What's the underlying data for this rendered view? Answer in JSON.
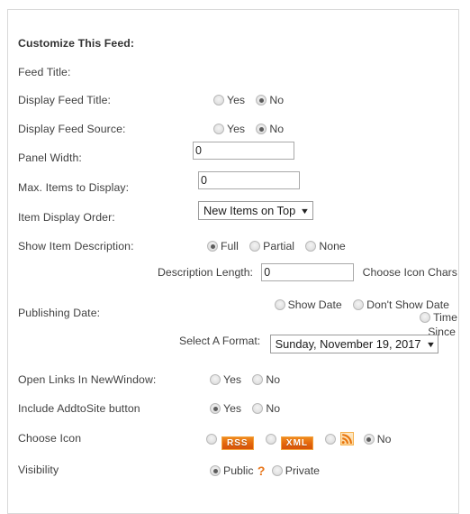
{
  "panel": {
    "title": "Customize This Feed:"
  },
  "fields": {
    "feed_title": {
      "label": "Feed Title:"
    },
    "display_feed_title": {
      "label": "Display Feed Title:",
      "options": [
        {
          "label": "Yes",
          "selected": false
        },
        {
          "label": "No",
          "selected": true
        }
      ]
    },
    "display_feed_source": {
      "label": "Display Feed Source:",
      "options": [
        {
          "label": "Yes",
          "selected": false
        },
        {
          "label": "No",
          "selected": true
        }
      ]
    },
    "panel_width": {
      "label": "Panel Width:",
      "value": "0"
    },
    "max_items": {
      "label": "Max. Items to Display:",
      "value": "0"
    },
    "item_display_order": {
      "label": "Item Display Order:",
      "selected": "New Items on Top",
      "arrow": "▼"
    },
    "show_item_description": {
      "label": "Show Item Description:",
      "options": [
        {
          "label": "Full",
          "selected": true
        },
        {
          "label": "Partial",
          "selected": false
        },
        {
          "label": "None",
          "selected": false
        }
      ]
    },
    "description_length": {
      "label": "Description Length:",
      "value": "0",
      "suffix": "Choose Icon  Chars"
    },
    "publishing_date": {
      "label": "Publishing Date:",
      "options": [
        {
          "label": "Show Date",
          "selected": false
        },
        {
          "label": "Don't Show Date",
          "selected": false
        },
        {
          "label": "Time",
          "selected": false
        }
      ],
      "wrap_label": "Since"
    },
    "select_format": {
      "label": "Select A Format:",
      "selected": "Sunday, November 19, 2017",
      "arrow": "▼"
    },
    "open_links_new_window": {
      "label": "Open Links In NewWindow:",
      "options": [
        {
          "label": "Yes",
          "selected": false
        },
        {
          "label": "No",
          "selected": false
        }
      ]
    },
    "include_addtosite": {
      "label": "Include AddtoSite button",
      "options": [
        {
          "label": "Yes",
          "selected": true
        },
        {
          "label": "No",
          "selected": false
        }
      ]
    },
    "choose_icon": {
      "label": "Choose Icon",
      "options": [
        {
          "label": "RSS",
          "kind": "badge",
          "selected": false
        },
        {
          "label": "XML",
          "kind": "badge",
          "selected": false
        },
        {
          "label": "feed-icon",
          "kind": "icon",
          "selected": false
        },
        {
          "label": "No",
          "kind": "text",
          "selected": true
        }
      ]
    },
    "visibility": {
      "label": "Visibility",
      "help": "?",
      "options": [
        {
          "label": "Public",
          "selected": true
        },
        {
          "label": "Private",
          "selected": false
        }
      ]
    }
  },
  "colors": {
    "accent_orange": "#e2650b",
    "help_orange": "#e8761b",
    "text": "#3f3f3f",
    "border": "#d9d9d9"
  }
}
